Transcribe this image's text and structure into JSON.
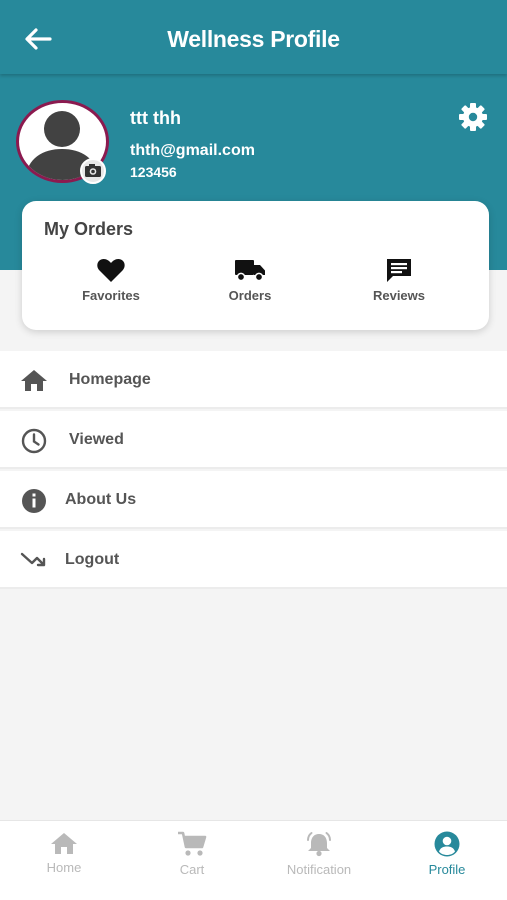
{
  "appbar": {
    "title": "Wellness Profile"
  },
  "profile": {
    "name": "ttt thh",
    "email": "thth@gmail.com",
    "phone": "123456"
  },
  "orders": {
    "title": "My Orders",
    "items": [
      {
        "label": "Favorites",
        "icon": "heart-icon"
      },
      {
        "label": "Orders",
        "icon": "truck-icon"
      },
      {
        "label": "Reviews",
        "icon": "message-icon"
      }
    ]
  },
  "menu": {
    "items": [
      {
        "label": "Homepage",
        "icon": "home-icon"
      },
      {
        "label": "Viewed",
        "icon": "clock-icon"
      },
      {
        "label": "About Us",
        "icon": "info-icon"
      },
      {
        "label": "Logout",
        "icon": "logout-icon"
      }
    ]
  },
  "bottom_nav": {
    "items": [
      {
        "label": "Home",
        "icon": "home-icon"
      },
      {
        "label": "Cart",
        "icon": "cart-icon"
      },
      {
        "label": "Notification",
        "icon": "bell-icon"
      },
      {
        "label": "Profile",
        "icon": "account-circle-icon",
        "active": true
      }
    ]
  },
  "colors": {
    "primary": "#27899b",
    "avatar_border": "#8b1a4f",
    "inactive": "#b9b9b9",
    "text": "#555555"
  }
}
